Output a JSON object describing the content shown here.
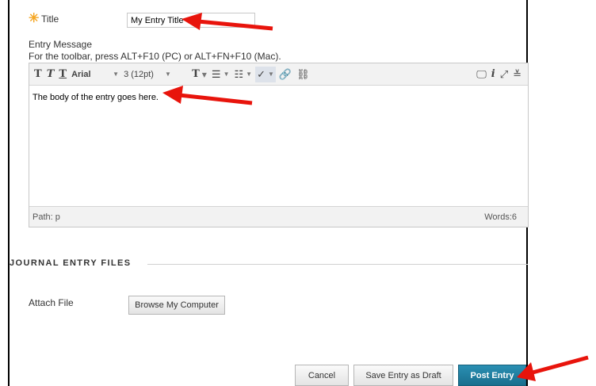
{
  "form": {
    "title_label": "Title",
    "title_value": "My Entry Title",
    "message_label": "Entry Message",
    "toolbar_hint": "For the toolbar, press ALT+F10 (PC) or ALT+FN+F10 (Mac).",
    "font_family": "Arial",
    "font_size": "3 (12pt)",
    "body_text": "The body of the entry goes here.",
    "path_label": "Path: p",
    "word_count": "Words:6"
  },
  "files": {
    "section_title": "JOURNAL ENTRY FILES",
    "attach_label": "Attach File",
    "browse_button": "Browse My Computer"
  },
  "actions": {
    "cancel": "Cancel",
    "save_draft": "Save Entry as Draft",
    "post": "Post Entry"
  },
  "colors": {
    "required_star": "#f5a623",
    "primary_button": "#1a6f8e",
    "annotation_arrow": "#e8140c"
  }
}
